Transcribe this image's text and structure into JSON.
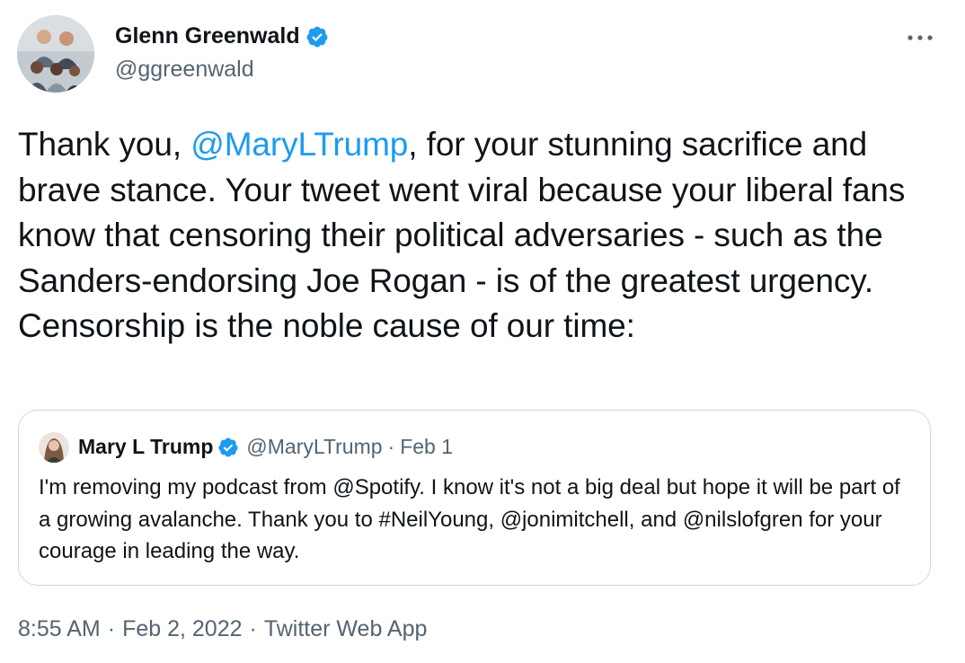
{
  "author": {
    "name": "Glenn Greenwald",
    "handle": "@ggreenwald",
    "verified": true
  },
  "tweet": {
    "text_before_mention": "Thank you, ",
    "mention": "@MaryLTrump",
    "text_after_mention": ", for your stunning sacrifice and brave stance. Your tweet went viral because your liberal fans know that censoring their political adversaries - such as the Sanders-endorsing Joe Rogan - is of the greatest urgency. Censorship is the noble cause of our time:"
  },
  "quoted_tweet": {
    "name": "Mary L Trump",
    "handle": "@MaryLTrump",
    "separator": "·",
    "date": "Feb 1",
    "verified": true,
    "text": "I'm removing my podcast from @Spotify. I know it's not a big deal but hope it will be part of a growing avalanche. Thank you to #NeilYoung, @jonimitchell, and @nilslofgren for your courage in leading the way."
  },
  "meta": {
    "time": "8:55 AM",
    "date": "Feb 2, 2022",
    "source": "Twitter Web App",
    "separator": "·"
  },
  "icons": {
    "more": "more-horizontal-icon",
    "verified": "verified-badge-icon"
  },
  "colors": {
    "link": "#1d9bf0",
    "secondary_text": "#536471",
    "border": "#cfd9de",
    "verified_badge": "#1d9bf0"
  }
}
